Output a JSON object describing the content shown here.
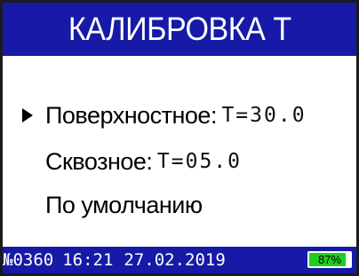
{
  "header": {
    "title": "КАЛИБРОВКА Т"
  },
  "menu": {
    "items": [
      {
        "label": "Поверхностное",
        "value": "T=30.0",
        "selected": true
      },
      {
        "label": "Сквозное",
        "value": "T=05.0",
        "selected": false
      },
      {
        "label": "По умолчанию",
        "value": "",
        "selected": false
      }
    ]
  },
  "status": {
    "device_number": "№0360",
    "time": "16:21",
    "date": "27.02.2019",
    "battery_label": "87%",
    "battery_level": 0.87
  },
  "colors": {
    "bar": "#161aa6",
    "battery_fill": "#1fcf1f",
    "background": "#ffffff"
  },
  "icons": {
    "cursor": "triangle-right-icon",
    "battery": "battery-icon"
  }
}
